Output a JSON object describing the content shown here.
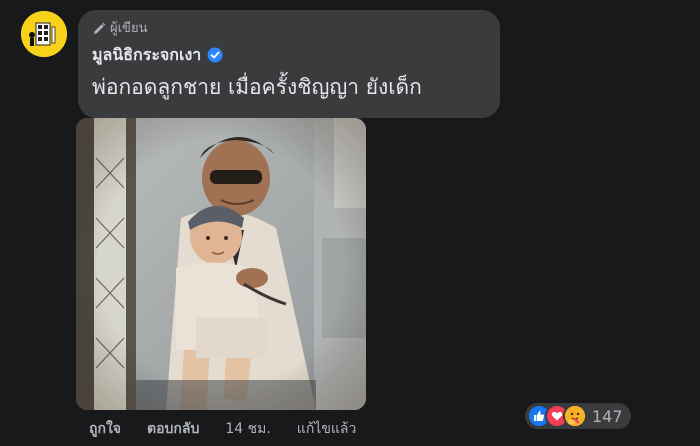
{
  "comment": {
    "badge": "ผู้เขียน",
    "author": "มูลนิธิกระจกเงา",
    "text": "พ่อกอดลูกชาย เมื่อครั้งชิญญา ยังเด็ก",
    "verified": true
  },
  "actions": {
    "like": "ถูกใจ",
    "reply": "ตอบกลับ",
    "time": "14 ชม.",
    "edited": "แก้ไขแล้ว"
  },
  "reactions": {
    "types": [
      "like",
      "love",
      "care"
    ],
    "count": "147"
  },
  "icons": {
    "badge": "pencil-icon",
    "verified": "verified-check-icon",
    "like": "thumbs-up-icon",
    "love": "heart-icon",
    "care": "care-hug-icon"
  },
  "colors": {
    "background": "#18191a",
    "bubble": "#3a3b3c",
    "primary_text": "#e4e6eb",
    "secondary_text": "#b0b3b8",
    "verified_blue": "#2d88ff",
    "like_blue": "#1877f2",
    "love_red": "#f33e58",
    "care_yellow": "#f7b125",
    "avatar_yellow": "#f6d21b"
  }
}
